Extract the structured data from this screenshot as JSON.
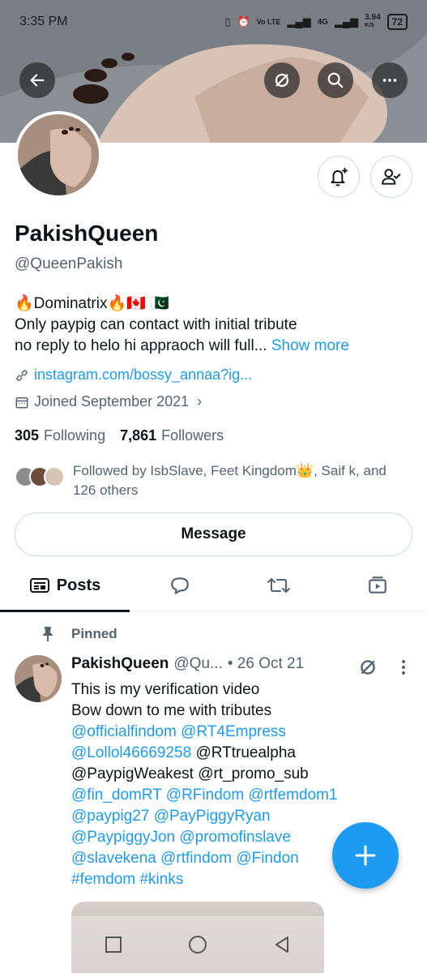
{
  "status_bar": {
    "time": "3:35 PM",
    "net_speed": "3.94",
    "net_unit": "K/S",
    "battery": "72",
    "network_label": "4G",
    "volte_label": "Vo LTE"
  },
  "header": {
    "back_icon": "arrow-left-icon",
    "grok_icon": "grok-icon",
    "search_icon": "search-icon",
    "more_icon": "more-horizontal-icon"
  },
  "profile": {
    "name": "PakishQueen",
    "handle": "@QueenPakish",
    "bio_line1": "🔥Dominatrix🔥🇨🇦 🇵🇰",
    "bio_line2": "Only paypig can contact with initial tribute",
    "bio_line3": "no reply to helo hi appraoch will full...",
    "show_more": "Show more",
    "website": "instagram.com/bossy_annaa?ig...",
    "joined": "Joined September 2021",
    "following_count": "305",
    "following_label": "Following",
    "followers_count": "7,861",
    "followers_label": "Followers",
    "followed_by": "Followed by IsbSlave, Feet Kingdom👑, Saif k, and 126 others",
    "message_label": "Message"
  },
  "tabs": [
    {
      "label": "Posts",
      "icon": "posts-icon",
      "active": true
    },
    {
      "label": "",
      "icon": "reply-icon",
      "active": false
    },
    {
      "label": "",
      "icon": "repost-icon",
      "active": false
    },
    {
      "label": "",
      "icon": "media-icon",
      "active": false
    }
  ],
  "pinned_post": {
    "pinned_label": "Pinned",
    "author_name": "PakishQueen",
    "author_handle": "@Qu...",
    "date": "• 26 Oct 21",
    "line1": "This is my verification video",
    "line2": "Bow down to me with tributes",
    "mentions_1": "@officialfindom @RT4Empress",
    "mentions_2a": "@Lollol46669258",
    "mentions_2b": " @RTtruealpha",
    "mentions_3": "@PaypigWeakest @rt_promo_sub",
    "mentions_4": "@fin_domRT @RFindom @rtfemdom1",
    "mentions_5": "@paypig27 @PayPiggyRyan",
    "mentions_6": "@PaypiggyJon @promofinslave",
    "mentions_7": "@slavekena @rtfindom @Findon",
    "hashtags": "#femdom #kinks"
  },
  "colors": {
    "accent": "#1d9bf0",
    "text_primary": "#0f1419",
    "text_secondary": "#536471",
    "border": "#cfd9de"
  }
}
